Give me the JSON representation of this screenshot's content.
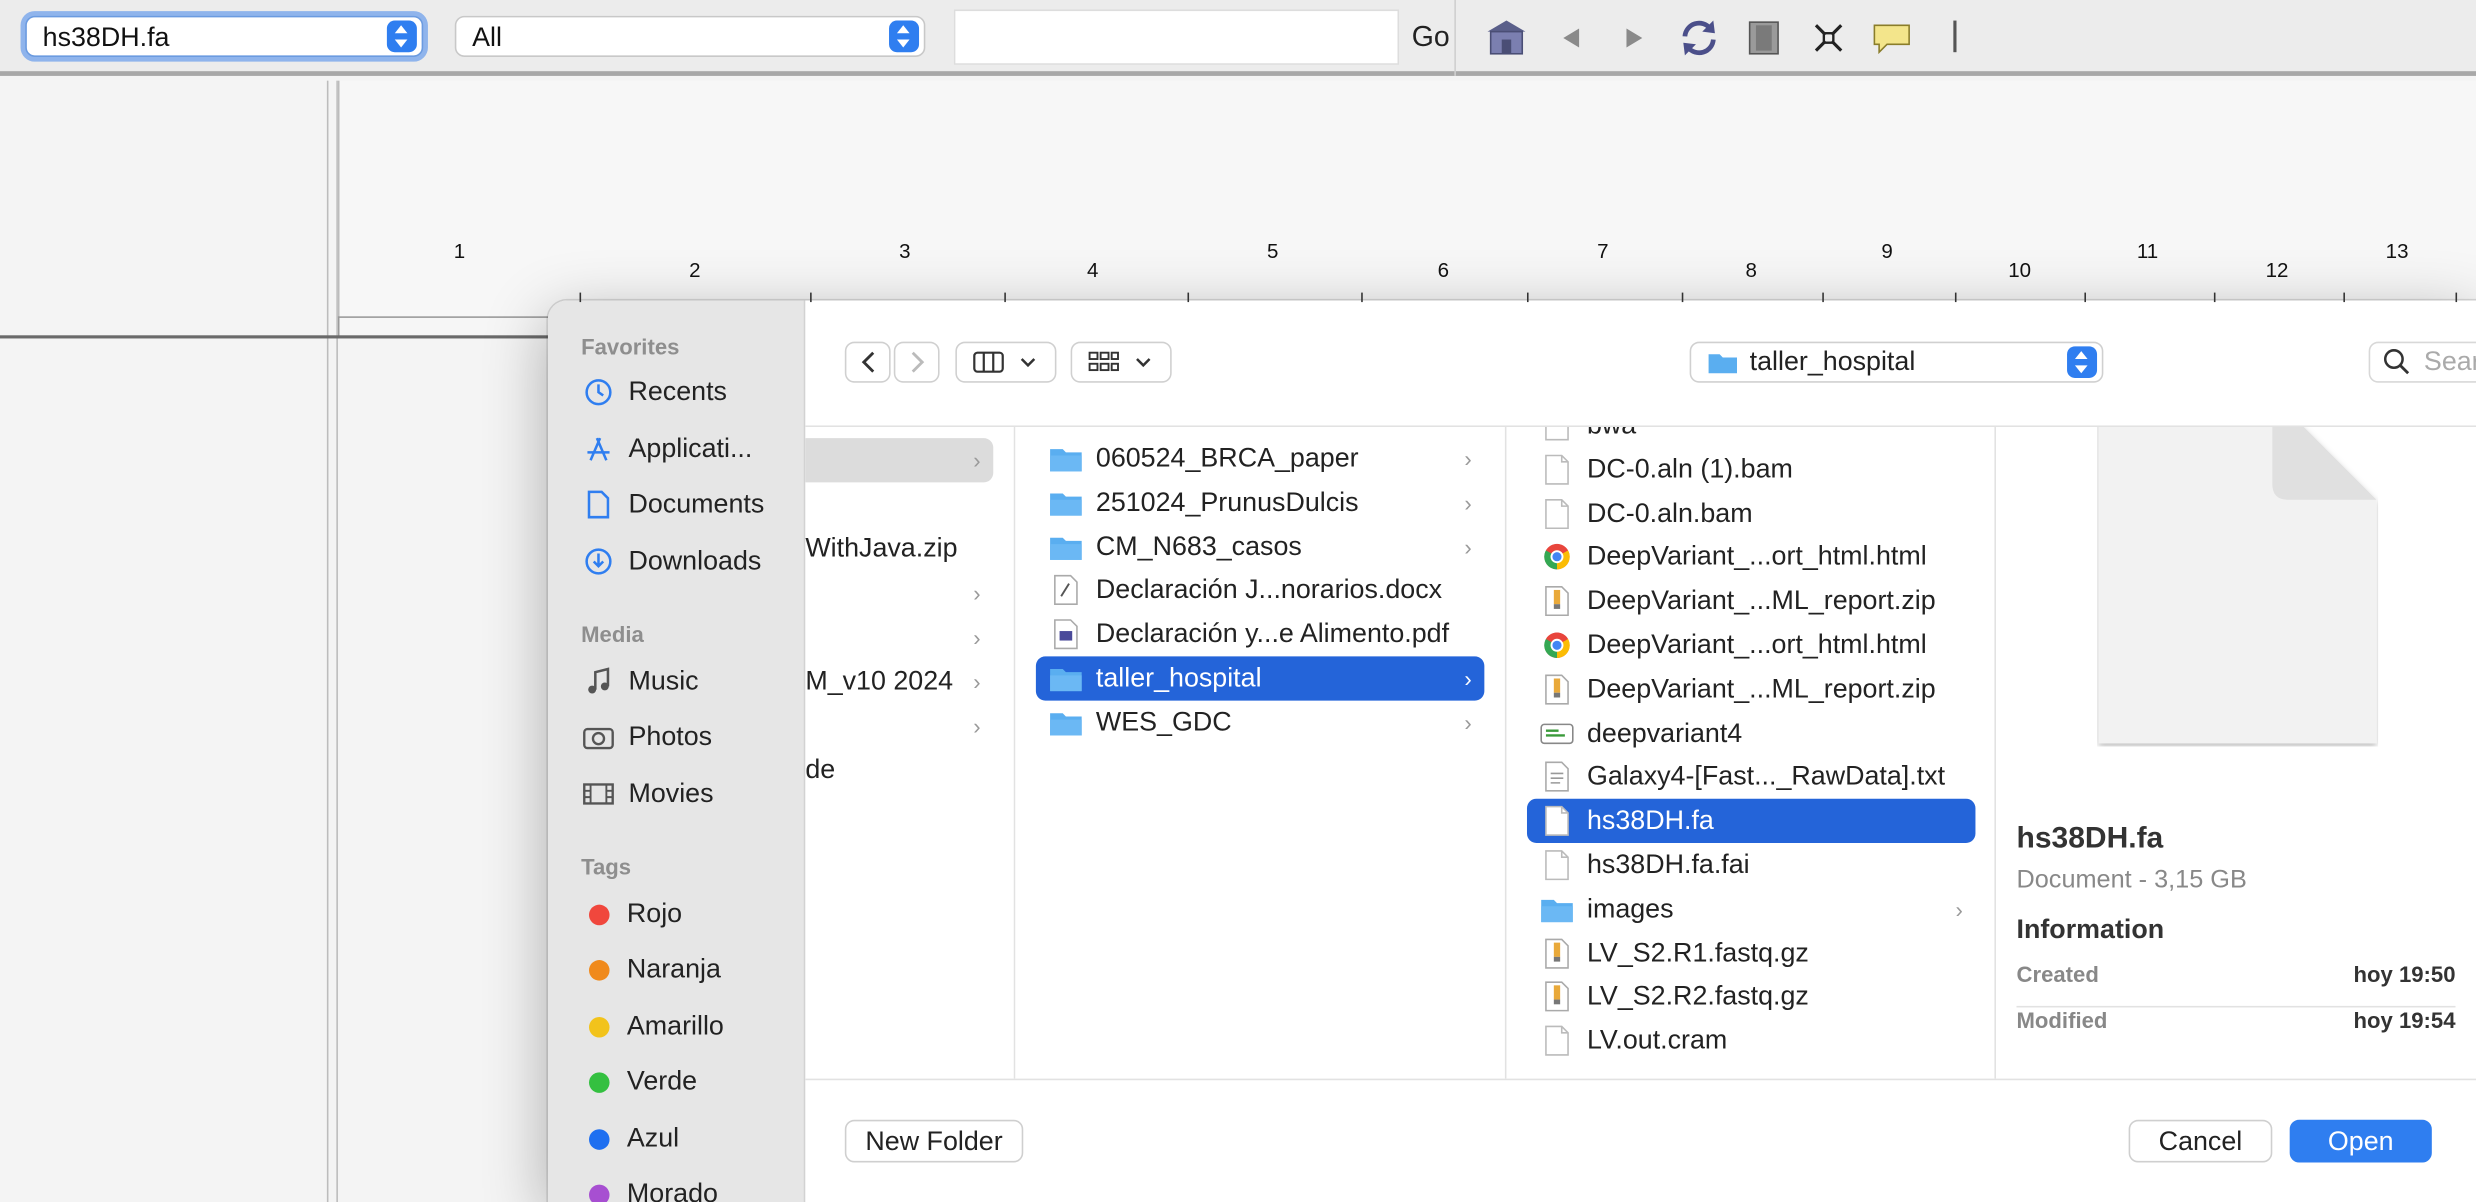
{
  "toolbar": {
    "genome": "hs38DH.fa",
    "chromosome": "All",
    "locus": "",
    "go_label": "Go"
  },
  "ruler": {
    "labels": [
      "1",
      "2",
      "3",
      "4",
      "5",
      "6",
      "7",
      "8",
      "9",
      "10",
      "11",
      "12",
      "13"
    ]
  },
  "dialog": {
    "sidebar": {
      "favorites_header": "Favorites",
      "favorites": [
        {
          "label": "Recents",
          "icon": "clock-icon"
        },
        {
          "label": "Applicati...",
          "icon": "applications-icon"
        },
        {
          "label": "Documents",
          "icon": "document-icon"
        },
        {
          "label": "Downloads",
          "icon": "download-icon"
        }
      ],
      "media_header": "Media",
      "media": [
        {
          "label": "Music",
          "icon": "music-note-icon"
        },
        {
          "label": "Photos",
          "icon": "camera-icon"
        },
        {
          "label": "Movies",
          "icon": "film-icon"
        }
      ],
      "tags_header": "Tags",
      "tags": [
        {
          "label": "Rojo",
          "color": "#f0473d"
        },
        {
          "label": "Naranja",
          "color": "#f08a1c"
        },
        {
          "label": "Amarillo",
          "color": "#f2c31b"
        },
        {
          "label": "Verde",
          "color": "#34c040"
        },
        {
          "label": "Azul",
          "color": "#1e6ff0"
        },
        {
          "label": "Morado",
          "color": "#a74fd1"
        }
      ]
    },
    "path_popup": "taller_hospital",
    "search_placeholder": "Search",
    "col1": [
      "WithJava.zip",
      "M_v10 2024",
      "de"
    ],
    "col2": [
      {
        "name": "060524_BRCA_paper",
        "type": "folder"
      },
      {
        "name": "251024_PrunusDulcis",
        "type": "folder"
      },
      {
        "name": "CM_N683_casos",
        "type": "folder"
      },
      {
        "name": "Declaración J...norarios.docx",
        "type": "docx"
      },
      {
        "name": "Declaración y...e Alimento.pdf",
        "type": "pdf"
      },
      {
        "name": "taller_hospital",
        "type": "folder",
        "selected": true
      },
      {
        "name": "WES_GDC",
        "type": "folder"
      }
    ],
    "col3": [
      {
        "name": "bwa",
        "type": "file"
      },
      {
        "name": "DC-0.aln (1).bam",
        "type": "file"
      },
      {
        "name": "DC-0.aln.bam",
        "type": "file"
      },
      {
        "name": "DeepVariant_...ort_html.html",
        "type": "html"
      },
      {
        "name": "DeepVariant_...ML_report.zip",
        "type": "zip"
      },
      {
        "name": "DeepVariant_...ort_html.html",
        "type": "html"
      },
      {
        "name": "DeepVariant_...ML_report.zip",
        "type": "zip"
      },
      {
        "name": "deepvariant4",
        "type": "exec"
      },
      {
        "name": "Galaxy4-[Fast..._RawData].txt",
        "type": "txt"
      },
      {
        "name": "hs38DH.fa",
        "type": "file",
        "selected": true
      },
      {
        "name": "hs38DH.fa.fai",
        "type": "file"
      },
      {
        "name": "images",
        "type": "folder"
      },
      {
        "name": "LV_S2.R1.fastq.gz",
        "type": "zip"
      },
      {
        "name": "LV_S2.R2.fastq.gz",
        "type": "zip"
      },
      {
        "name": "LV.out.cram",
        "type": "file"
      }
    ],
    "preview": {
      "filename": "hs38DH.fa",
      "kind": "Document - 3,15 GB",
      "info_header": "Information",
      "created_label": "Created",
      "created_value": "hoy 19:50",
      "modified_label": "Modified",
      "modified_value": "hoy 19:54"
    },
    "new_folder": "New Folder",
    "cancel": "Cancel",
    "open": "Open"
  }
}
